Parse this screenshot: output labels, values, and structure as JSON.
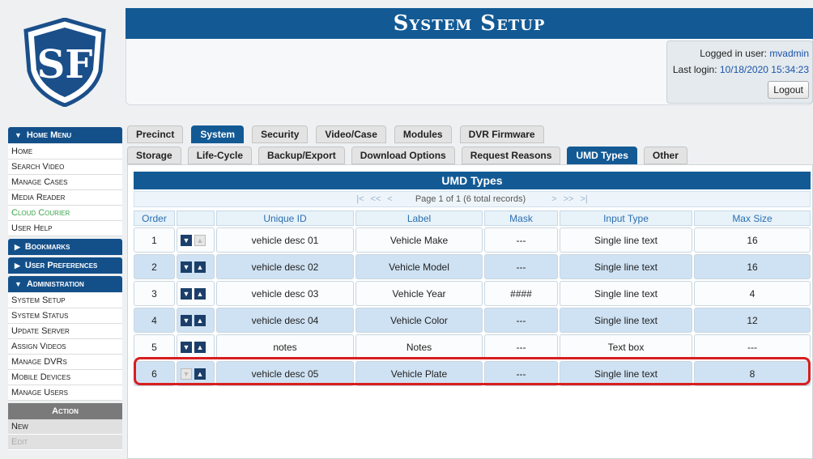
{
  "header": {
    "title": "System Setup",
    "login_label": "Logged in user:",
    "login_user": "mvadmin",
    "last_login_label": "Last login:",
    "last_login_value": "10/18/2020 15:34:23",
    "logout_label": "Logout"
  },
  "colors": {
    "brand": "#135a95",
    "highlight": "#d81e1e",
    "row_alt": "#cfe2f3"
  },
  "sidebar": {
    "home_menu": "Home Menu",
    "home_items": [
      "Home",
      "Search Video",
      "Manage Cases",
      "Media Reader",
      "Cloud Courier",
      "User Help"
    ],
    "bookmarks": "Bookmarks",
    "user_prefs": "User Preferences",
    "administration": "Administration",
    "admin_items": [
      "System Setup",
      "System Status",
      "Update Server",
      "Assign Videos",
      "Manage DVRs",
      "Mobile Devices",
      "Manage Users"
    ],
    "action": "Action",
    "action_items": [
      "New",
      "Edit"
    ]
  },
  "tabs_row1": [
    "Precinct",
    "System",
    "Security",
    "Video/Case",
    "Modules",
    "DVR Firmware"
  ],
  "tabs_row2": [
    "Storage",
    "Life-Cycle",
    "Backup/Export",
    "Download Options",
    "Request Reasons",
    "UMD Types",
    "Other"
  ],
  "table": {
    "title": "UMD Types",
    "pager_text": "Page 1 of 1 (6 total records)",
    "pager_first": "|<",
    "pager_prev2": "<<",
    "pager_prev": "<",
    "pager_next": ">",
    "pager_next2": ">>",
    "pager_last": ">|",
    "headers": [
      "Order",
      "",
      "Unique ID",
      "Label",
      "Mask",
      "Input Type",
      "Max Size"
    ],
    "rows": [
      {
        "order": "1",
        "unique_id": "vehicle desc 01",
        "label": "Vehicle Make",
        "mask": "---",
        "input_type": "Single line text",
        "max_size": "16",
        "down": true,
        "up": false
      },
      {
        "order": "2",
        "unique_id": "vehicle desc 02",
        "label": "Vehicle Model",
        "mask": "---",
        "input_type": "Single line text",
        "max_size": "16",
        "down": true,
        "up": true
      },
      {
        "order": "3",
        "unique_id": "vehicle desc 03",
        "label": "Vehicle Year",
        "mask": "####",
        "input_type": "Single line text",
        "max_size": "4",
        "down": true,
        "up": true
      },
      {
        "order": "4",
        "unique_id": "vehicle desc 04",
        "label": "Vehicle Color",
        "mask": "---",
        "input_type": "Single line text",
        "max_size": "12",
        "down": true,
        "up": true
      },
      {
        "order": "5",
        "unique_id": "notes",
        "label": "Notes",
        "mask": "---",
        "input_type": "Text box",
        "max_size": "---",
        "down": true,
        "up": true
      },
      {
        "order": "6",
        "unique_id": "vehicle desc 05",
        "label": "Vehicle Plate",
        "mask": "---",
        "input_type": "Single line text",
        "max_size": "8",
        "down": false,
        "up": true
      }
    ]
  }
}
